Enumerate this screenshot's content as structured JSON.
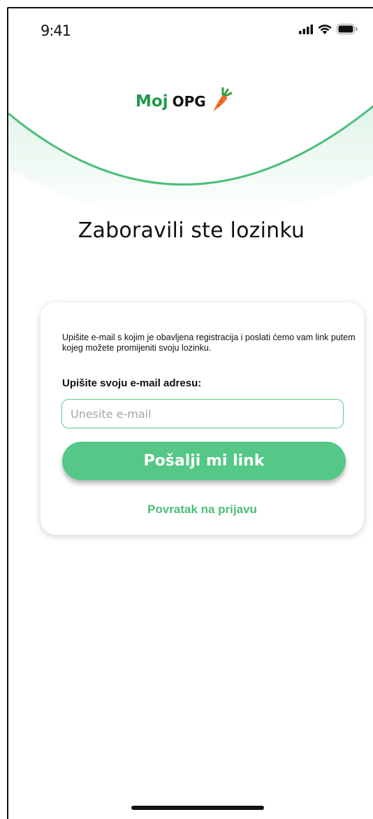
{
  "status_bar": {
    "time": "9:41",
    "icons": [
      "signal-icon",
      "wifi-icon",
      "battery-icon"
    ]
  },
  "logo": {
    "part1": "Moj",
    "part2": "OPG",
    "icon": "carrot-icon",
    "colors": {
      "moj": "#1f9a4a",
      "opg": "#111111"
    }
  },
  "page": {
    "title": "Zaboravili ste lozinku"
  },
  "card": {
    "description": "Upišite e-mail s kojim je obavljena registracija i poslati ćemo vam link putem kojeg možete promijeniti svoju lozinku.",
    "field_label": "Upišite svoju e-mail adresu:",
    "email_value": "",
    "email_placeholder": "Unesite e-mail",
    "send_button_label": "Pošalji mi link",
    "back_link_label": "Povratak na prijavu"
  },
  "colors": {
    "accent": "#55c787",
    "accent_dark": "#1f9a4a",
    "link": "#4cbf7c",
    "input_border": "#5cc98a"
  }
}
